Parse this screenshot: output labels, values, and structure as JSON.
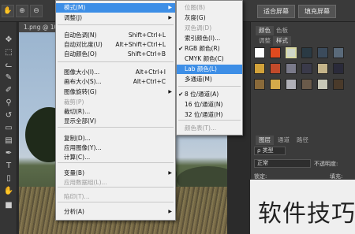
{
  "toolbar": {
    "fit_screen_label": "适合屏幕",
    "fill_screen_label": "填充屏幕"
  },
  "document": {
    "tab_label": "1.png @ 100"
  },
  "image_menu": {
    "items": [
      {
        "label": "模式(M)",
        "shortcut": "",
        "submenu": true,
        "disabled": false
      },
      {
        "label": "调整(J)",
        "shortcut": "",
        "submenu": true,
        "disabled": false
      },
      {
        "label": "自动色调(N)",
        "shortcut": "Shift+Ctrl+L",
        "submenu": false,
        "disabled": false
      },
      {
        "label": "自动对比度(U)",
        "shortcut": "Alt+Shift+Ctrl+L",
        "submenu": false,
        "disabled": false
      },
      {
        "label": "自动颜色(O)",
        "shortcut": "Shift+Ctrl+B",
        "submenu": false,
        "disabled": false
      },
      {
        "label": "图像大小(I)...",
        "shortcut": "Alt+Ctrl+I",
        "submenu": false,
        "disabled": false
      },
      {
        "label": "画布大小(S)...",
        "shortcut": "Alt+Ctrl+C",
        "submenu": false,
        "disabled": false
      },
      {
        "label": "图像旋转(G)",
        "shortcut": "",
        "submenu": true,
        "disabled": false
      },
      {
        "label": "裁剪(P)",
        "shortcut": "",
        "submenu": false,
        "disabled": true
      },
      {
        "label": "裁切(R)...",
        "shortcut": "",
        "submenu": false,
        "disabled": false
      },
      {
        "label": "显示全部(V)",
        "shortcut": "",
        "submenu": false,
        "disabled": false
      },
      {
        "label": "复制(D)...",
        "shortcut": "",
        "submenu": false,
        "disabled": false
      },
      {
        "label": "应用图像(Y)...",
        "shortcut": "",
        "submenu": false,
        "disabled": false
      },
      {
        "label": "计算(C)...",
        "shortcut": "",
        "submenu": false,
        "disabled": false
      },
      {
        "label": "变量(B)",
        "shortcut": "",
        "submenu": true,
        "disabled": false
      },
      {
        "label": "应用数据组(L)...",
        "shortcut": "",
        "submenu": false,
        "disabled": true
      },
      {
        "label": "陷印(T)...",
        "shortcut": "",
        "submenu": false,
        "disabled": true
      },
      {
        "label": "分析(A)",
        "shortcut": "",
        "submenu": true,
        "disabled": false
      }
    ]
  },
  "mode_submenu": {
    "items": [
      {
        "label": "位图(B)",
        "checked": false,
        "disabled": true,
        "highlighted": false
      },
      {
        "label": "灰度(G)",
        "checked": false,
        "disabled": false,
        "highlighted": false
      },
      {
        "label": "双色调(D)",
        "checked": false,
        "disabled": true,
        "highlighted": false
      },
      {
        "label": "索引颜色(I)...",
        "checked": false,
        "disabled": false,
        "highlighted": false
      },
      {
        "label": "RGB 颜色(R)",
        "checked": true,
        "disabled": false,
        "highlighted": false
      },
      {
        "label": "CMYK 颜色(C)",
        "checked": false,
        "disabled": false,
        "highlighted": false
      },
      {
        "label": "Lab 颜色(L)",
        "checked": false,
        "disabled": false,
        "highlighted": true
      },
      {
        "label": "多通道(M)",
        "checked": false,
        "disabled": false,
        "highlighted": false
      },
      {
        "label": "8 位/通道(A)",
        "checked": true,
        "disabled": false,
        "highlighted": false
      },
      {
        "label": "16 位/通道(N)",
        "checked": false,
        "disabled": false,
        "highlighted": false
      },
      {
        "label": "32 位/通道(H)",
        "checked": false,
        "disabled": false,
        "highlighted": false
      },
      {
        "label": "颜色表(T)...",
        "checked": false,
        "disabled": true,
        "highlighted": false
      }
    ]
  },
  "right_panel": {
    "top_tabs": [
      "颜色",
      "色板"
    ],
    "style_tabs": [
      "调整",
      "样式"
    ],
    "layer_tabs": [
      "图层",
      "通道",
      "路径"
    ],
    "kind_label": "ρ 类型",
    "blend_mode": "正常",
    "opacity_label": "不透明度:",
    "lock_label": "锁定:",
    "fill_label": "填充:"
  },
  "watermark": {
    "text": "软件技巧"
  },
  "colors": {
    "highlight": "#3d8ee6",
    "menu_bg": "#f0f0f0",
    "panel_bg": "#3b3b3b"
  }
}
